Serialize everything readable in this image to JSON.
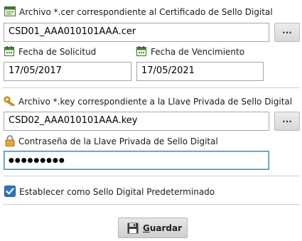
{
  "cer": {
    "label": "Archivo *.cer correspondiente al Certificado de Sello Digital",
    "value": "CSD01_AAA010101AAA.cer",
    "browse_label": "..."
  },
  "dates": {
    "solicitud_label": "Fecha de Solicitud",
    "solicitud_value": "17/05/2017",
    "vencimiento_label": "Fecha de Vencimiento",
    "vencimiento_value": "17/05/2021"
  },
  "key": {
    "label": "Archivo *.key correspondiente a la Llave Privada de Sello Digital",
    "value": "CSD02_AAA010101AAA.key",
    "browse_label": "..."
  },
  "password": {
    "label": "Contraseña de la Llave Privada de Sello Digital",
    "masked": "●●●●●●●●●"
  },
  "default_checkbox": {
    "label": "Establecer como Sello Digital Predeterminado",
    "checked": true
  },
  "save_button": {
    "accel": "G",
    "rest": "uardar"
  },
  "icons": {
    "certificate": "certificate-icon",
    "calendar": "calendar-icon",
    "key": "key-icon",
    "lock": "lock-icon",
    "save": "floppy-disk-icon"
  }
}
